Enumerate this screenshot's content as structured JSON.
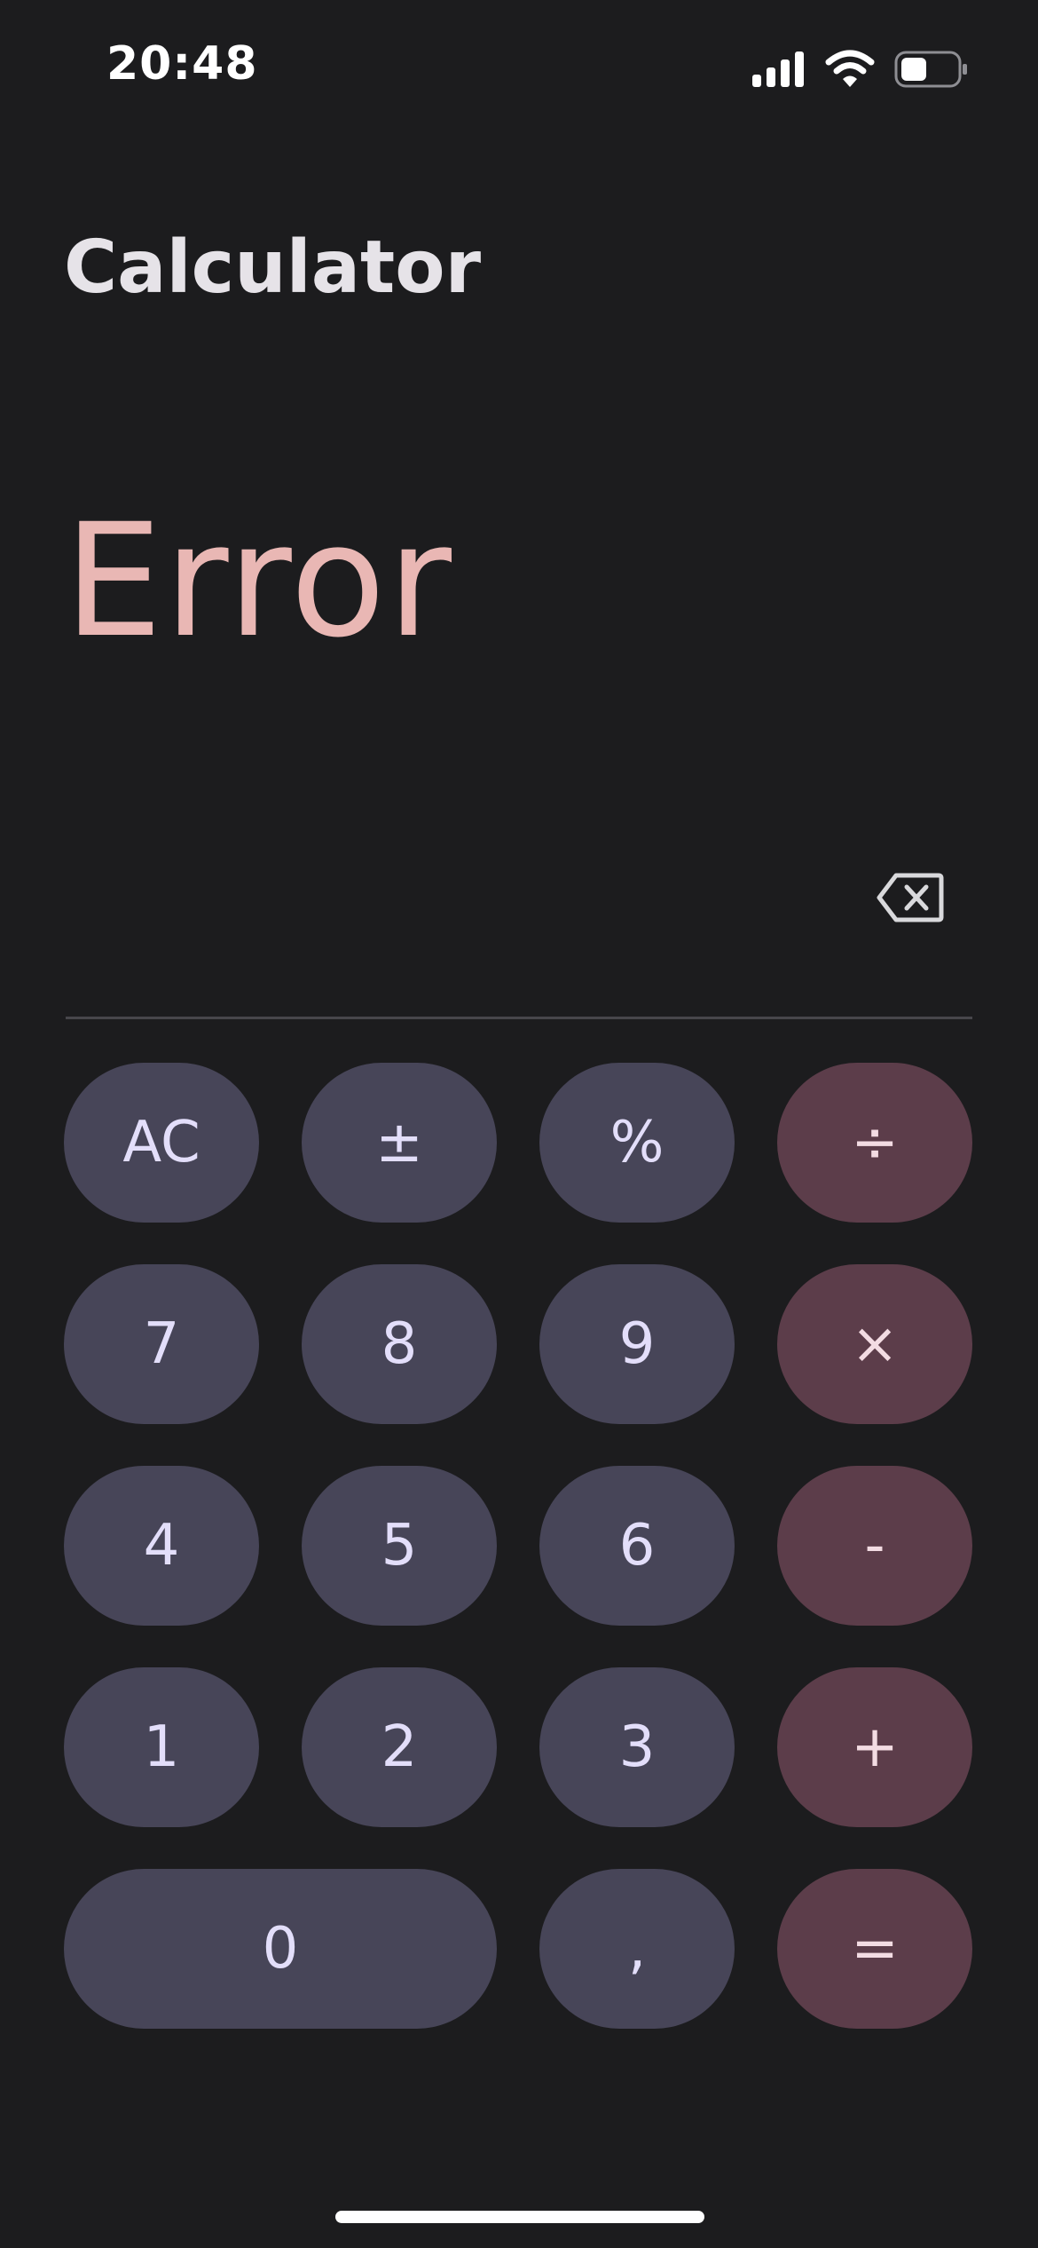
{
  "status_bar": {
    "time": "20:48",
    "icons": [
      "signal-icon",
      "wifi-icon",
      "battery-icon"
    ]
  },
  "app": {
    "title": "Calculator"
  },
  "display": {
    "value": "Error",
    "value_color": "#e9b7b4"
  },
  "backspace": {
    "icon": "backspace-icon"
  },
  "keys": {
    "ac": "AC",
    "plus_minus": "±",
    "percent": "%",
    "divide": "÷",
    "seven": "7",
    "eight": "8",
    "nine": "9",
    "multiply": "×",
    "four": "4",
    "five": "5",
    "six": "6",
    "minus": "-",
    "one": "1",
    "two": "2",
    "three": "3",
    "plus": "+",
    "zero": "0",
    "comma": ",",
    "equals": "="
  },
  "colors": {
    "background": "#1c1c1e",
    "number_key": "#474558",
    "operator_key": "#5c3d4a",
    "key_text": "#e3defa"
  }
}
